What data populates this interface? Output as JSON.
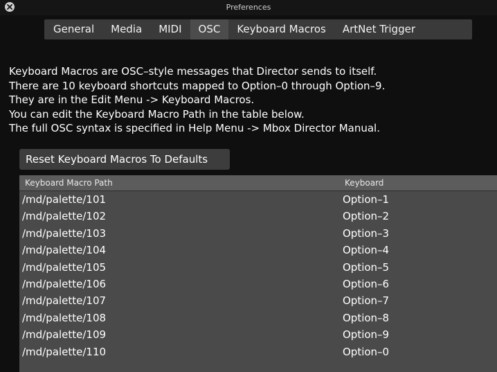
{
  "window": {
    "title": "Preferences"
  },
  "tabs": [
    {
      "label": "General",
      "selected": false
    },
    {
      "label": "Media",
      "selected": false
    },
    {
      "label": "MIDI",
      "selected": false
    },
    {
      "label": "OSC",
      "selected": false
    },
    {
      "label": "Keyboard Macros",
      "selected": false
    },
    {
      "label": "ArtNet Trigger",
      "selected": false
    }
  ],
  "description": [
    "Keyboard Macros are OSC–style messages that Director sends to itself.",
    "There are 10 keyboard shortcuts mapped to Option–0 through Option–9.",
    "They are in the Edit Menu -> Keyboard Macros.",
    "You can edit the Keyboard Macro Path in the table below.",
    "The full OSC syntax is specified in Help Menu -> Mbox Director Manual."
  ],
  "reset_button": {
    "label": "Reset Keyboard Macros To Defaults"
  },
  "table": {
    "columns": [
      "Keyboard Macro Path",
      "Keyboard"
    ],
    "rows": [
      {
        "path": "/md/palette/101",
        "key": "Option–1"
      },
      {
        "path": "/md/palette/102",
        "key": "Option–2"
      },
      {
        "path": "/md/palette/103",
        "key": "Option–3"
      },
      {
        "path": "/md/palette/104",
        "key": "Option–4"
      },
      {
        "path": "/md/palette/105",
        "key": "Option–5"
      },
      {
        "path": "/md/palette/106",
        "key": "Option–6"
      },
      {
        "path": "/md/palette/107",
        "key": "Option–7"
      },
      {
        "path": "/md/palette/108",
        "key": "Option–8"
      },
      {
        "path": "/md/palette/109",
        "key": "Option–9"
      },
      {
        "path": "/md/palette/110",
        "key": "Option–0"
      }
    ]
  },
  "icons": {
    "close": "close-icon"
  },
  "colors": {
    "window_background": "#0f0f0f",
    "tab_bar": "#3a3a3a",
    "selected_tab": "#4c4c4c",
    "table_background": "#4a4a4a",
    "table_header": "#5c5c5c",
    "text": "#ffffff"
  }
}
